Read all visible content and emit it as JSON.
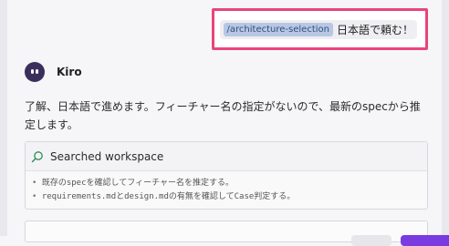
{
  "user_message": {
    "command": "/architecture-selection",
    "text": "日本語で頼む！"
  },
  "agent": {
    "name": "Kiro",
    "reply": "了解、日本語で進めます。フィーチャー名の指定がないので、最新のspecから推定します。"
  },
  "tool_call": {
    "title": "Searched workspace",
    "icon": "search-icon",
    "lines": [
      "既存のspecを確認してフィーチャー名を推定する。",
      "requirements.mdとdesign.mdの有無を確認してCase判定する。"
    ]
  },
  "colors": {
    "highlight_border": "#e8457a",
    "command_chip_bg": "#b8c7e3",
    "avatar_bg": "#3a2f5c",
    "primary_button": "#7a3be0"
  }
}
